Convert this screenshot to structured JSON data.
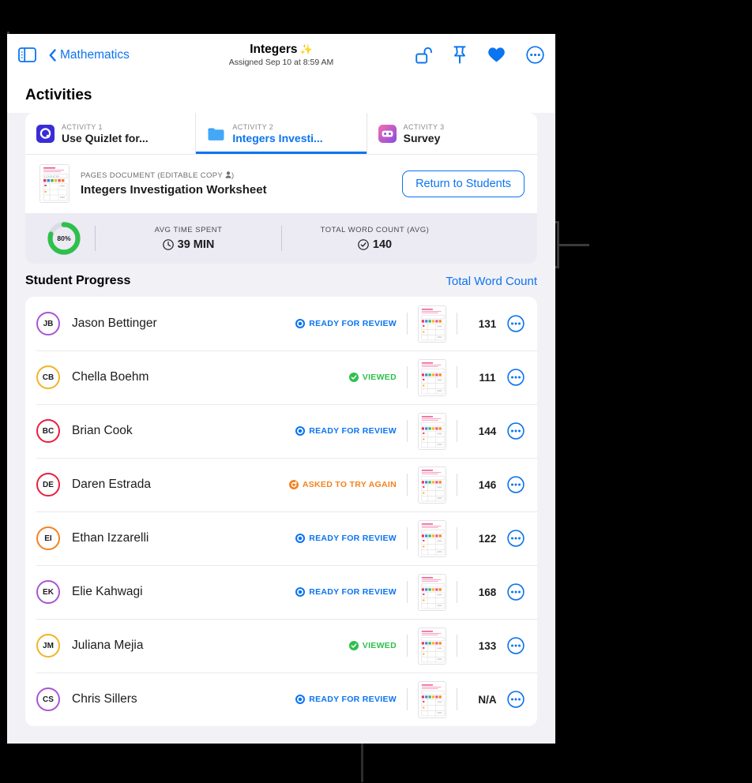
{
  "nav": {
    "sidebar_icon": "sidebar-toggle-icon",
    "back_label": "Mathematics",
    "title": "Integers",
    "title_sparkle": "✨",
    "subtitle": "Assigned Sep 10 at 8:59 AM",
    "actions": [
      {
        "name": "unlock-icon",
        "label": "Unlock"
      },
      {
        "name": "pin-icon",
        "label": "Pin"
      },
      {
        "name": "heart-icon",
        "label": "Favorite"
      },
      {
        "name": "more-options-icon",
        "label": "More"
      }
    ],
    "accent": "#0b74f0"
  },
  "section": {
    "activities_title": "Activities"
  },
  "tabs": [
    {
      "kicker": "ACTIVITY 1",
      "name": "Use Quizlet for...",
      "icon": "quizlet-icon",
      "active": false
    },
    {
      "kicker": "ACTIVITY 2",
      "name": "Integers Investi...",
      "icon": "folder-icon",
      "active": true
    },
    {
      "kicker": "ACTIVITY 3",
      "name": "Survey",
      "icon": "survey-icon",
      "active": false
    }
  ],
  "document": {
    "kicker": "PAGES DOCUMENT (EDITABLE COPY )",
    "kicker_text": "PAGES DOCUMENT (EDITABLE COPY",
    "kicker_suffix": ")",
    "name": "Integers Investigation Worksheet",
    "return_button": "Return to Students"
  },
  "stats": {
    "ring_percent": "80%",
    "ring_value": 80,
    "ring_color": "#2ec04b",
    "cells": [
      {
        "label": "AVG TIME SPENT",
        "value": "39 MIN",
        "icon": "clock-icon"
      },
      {
        "label": "TOTAL WORD COUNT (AVG)",
        "value": "140",
        "icon": "checkmark-seal-icon"
      }
    ]
  },
  "student_progress": {
    "title": "Student Progress",
    "link": "Total Word Count"
  },
  "statuses": {
    "ready": {
      "text": "READY FOR REVIEW",
      "color": "#0b74f0",
      "icon": "ready-circle-icon"
    },
    "viewed": {
      "text": "VIEWED",
      "color": "#2ec04b",
      "icon": "viewed-check-icon"
    },
    "retry": {
      "text": "ASKED TO TRY AGAIN",
      "color": "#f5821f",
      "icon": "retry-circle-icon"
    }
  },
  "students": [
    {
      "initials": "JB",
      "name": "Jason Bettinger",
      "ring": "#a855d8",
      "status": "ready",
      "count": "131"
    },
    {
      "initials": "CB",
      "name": "Chella Boehm",
      "ring": "#f0b429",
      "status": "viewed",
      "count": "111"
    },
    {
      "initials": "BC",
      "name": "Brian Cook",
      "ring": "#ea1f3d",
      "status": "ready",
      "count": "144"
    },
    {
      "initials": "DE",
      "name": "Daren Estrada",
      "ring": "#ea1f3d",
      "status": "retry",
      "count": "146"
    },
    {
      "initials": "EI",
      "name": "Ethan Izzarelli",
      "ring": "#f5821f",
      "status": "ready",
      "count": "122"
    },
    {
      "initials": "EK",
      "name": "Elie Kahwagi",
      "ring": "#a855d8",
      "status": "ready",
      "count": "168"
    },
    {
      "initials": "JM",
      "name": "Juliana Mejia",
      "ring": "#f0b429",
      "status": "viewed",
      "count": "133"
    },
    {
      "initials": "CS",
      "name": "Chris Sillers",
      "ring": "#a855d8",
      "status": "ready",
      "count": "N/A"
    }
  ]
}
